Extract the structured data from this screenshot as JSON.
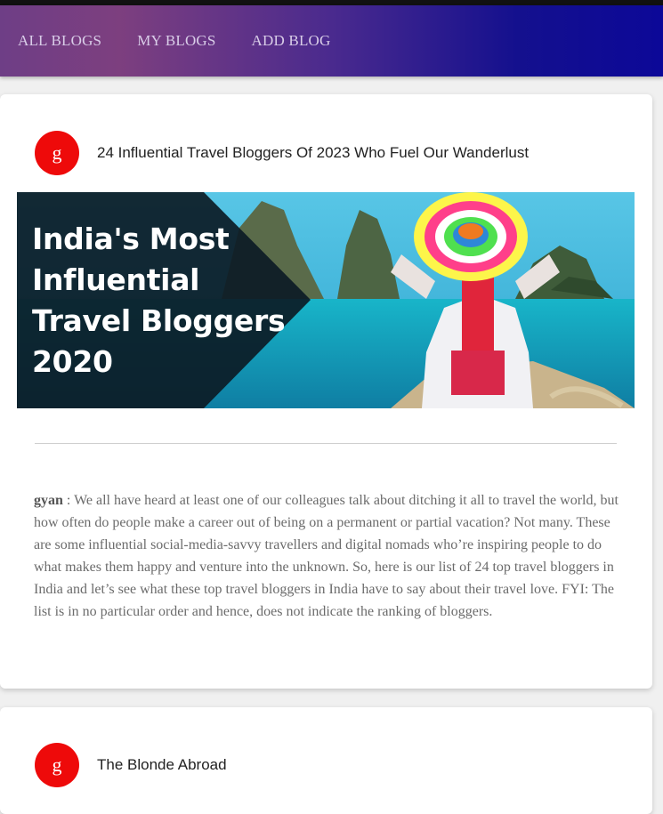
{
  "nav": {
    "items": [
      {
        "label": "ALL BLOGS"
      },
      {
        "label": "MY BLOGS"
      },
      {
        "label": "ADD BLOG"
      }
    ]
  },
  "posts": [
    {
      "avatar_letter": "g",
      "title": "24 Influential Travel Bloggers Of 2023 Who Fuel Our Wanderlust",
      "image": {
        "lines": [
          "India's Most",
          "Influential",
          "Travel Bloggers",
          "2020"
        ]
      },
      "author": "gyan",
      "separator": " : ",
      "body": "We all have heard at least one of our colleagues talk about ditching it all to travel the world, but how often do people make a career out of being on a permanent or partial vacation? Not many. These are some influential social-media-savvy travellers and digital nomads who’re inspiring people to do what makes them happy and venture into the unknown. So, here is our list of 24 top travel bloggers in India and let’s see what these top travel bloggers in India have to say about their travel love. FYI: The list is in no particular order and hence, does not indicate the ranking of bloggers."
    },
    {
      "avatar_letter": "g",
      "title": "The Blonde Abroad"
    }
  ],
  "colors": {
    "nav_gradient_start": "#6e3e86",
    "nav_gradient_end": "#0c0898",
    "avatar": "#ee0a0a"
  }
}
